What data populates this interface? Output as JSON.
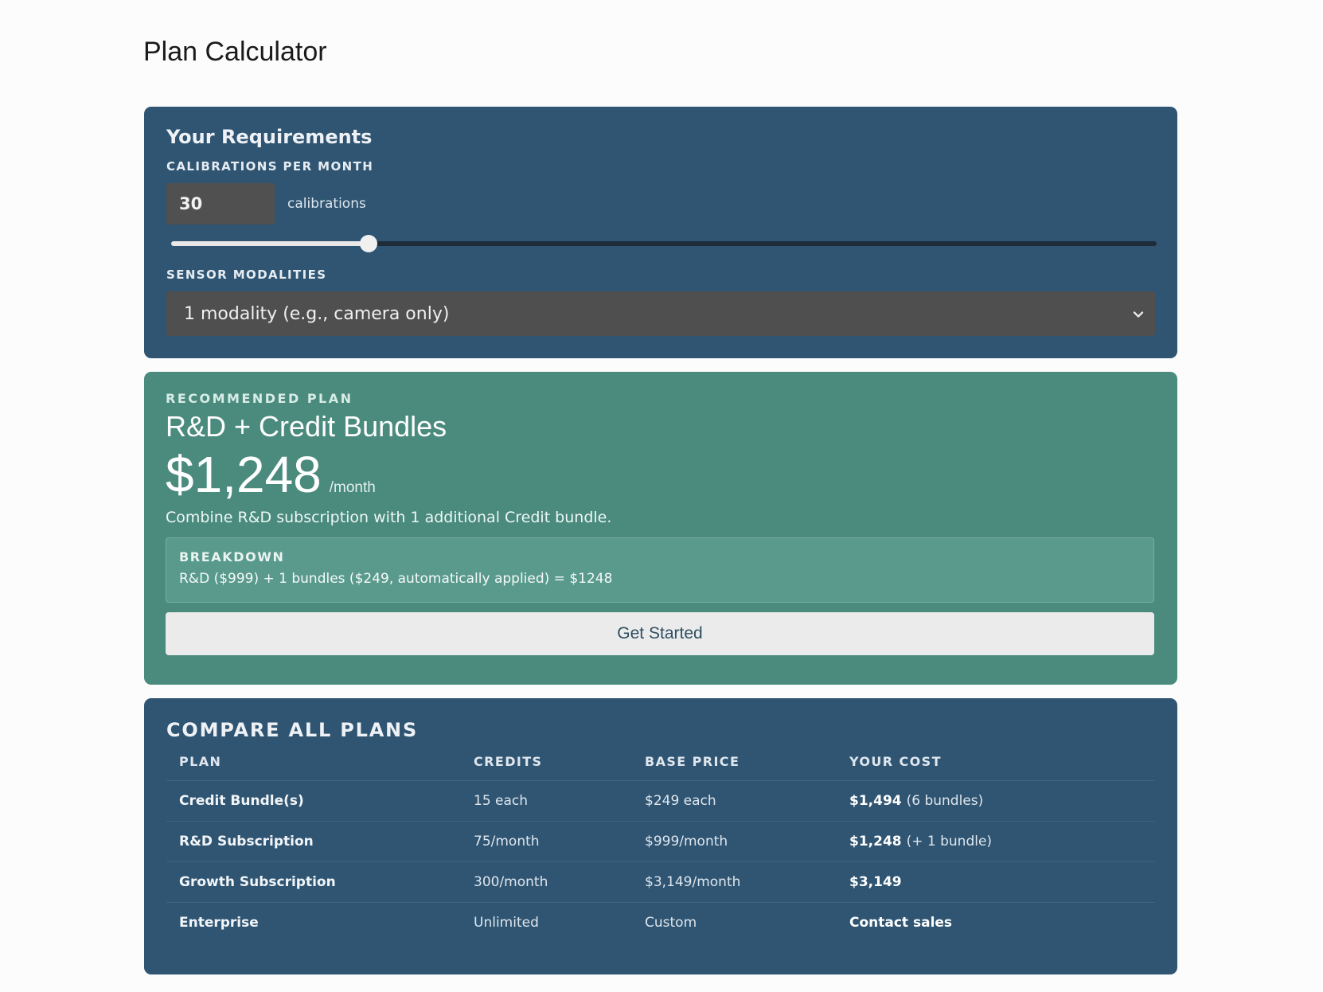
{
  "page_title": "Plan Calculator",
  "requirements": {
    "heading": "Your Requirements",
    "calibrations_label": "CALIBRATIONS PER MONTH",
    "calibrations_value": "30",
    "calibrations_unit": "calibrations",
    "slider_fraction": 0.2,
    "sensor_label": "SENSOR MODALITIES",
    "sensor_selected": "1 modality (e.g., camera only)"
  },
  "recommended": {
    "kicker": "RECOMMENDED PLAN",
    "name": "R&D + Credit Bundles",
    "price": "$1,248",
    "per": "/month",
    "description": "Combine R&D subscription with 1 additional Credit bundle.",
    "breakdown_label": "BREAKDOWN",
    "breakdown_text": "R&D ($999) + 1 bundles ($249, automatically applied) = $1248",
    "cta_label": "Get Started"
  },
  "compare": {
    "heading": "COMPARE ALL PLANS",
    "columns": [
      "PLAN",
      "CREDITS",
      "BASE PRICE",
      "YOUR COST"
    ],
    "rows": [
      {
        "plan": "Credit Bundle(s)",
        "credits": "15 each",
        "base_price": "$249 each",
        "cost": "$1,494",
        "cost_note": "(6 bundles)"
      },
      {
        "plan": "R&D Subscription",
        "credits": "75/month",
        "base_price": "$999/month",
        "cost": "$1,248",
        "cost_note": "(+ 1 bundle)"
      },
      {
        "plan": "Growth Subscription",
        "credits": "300/month",
        "base_price": "$3,149/month",
        "cost": "$3,149",
        "cost_note": ""
      },
      {
        "plan": "Enterprise",
        "credits": "Unlimited",
        "base_price": "Custom",
        "cost": "Contact sales",
        "cost_note": ""
      }
    ]
  },
  "colors": {
    "requirements_bg": "#2f5572",
    "recommended_bg": "#4a8b7e",
    "compare_bg": "#2f5572",
    "input_bg": "#505050",
    "button_bg": "#ebebeb"
  },
  "icons": {
    "select_chevron": "chevron-down-icon"
  }
}
